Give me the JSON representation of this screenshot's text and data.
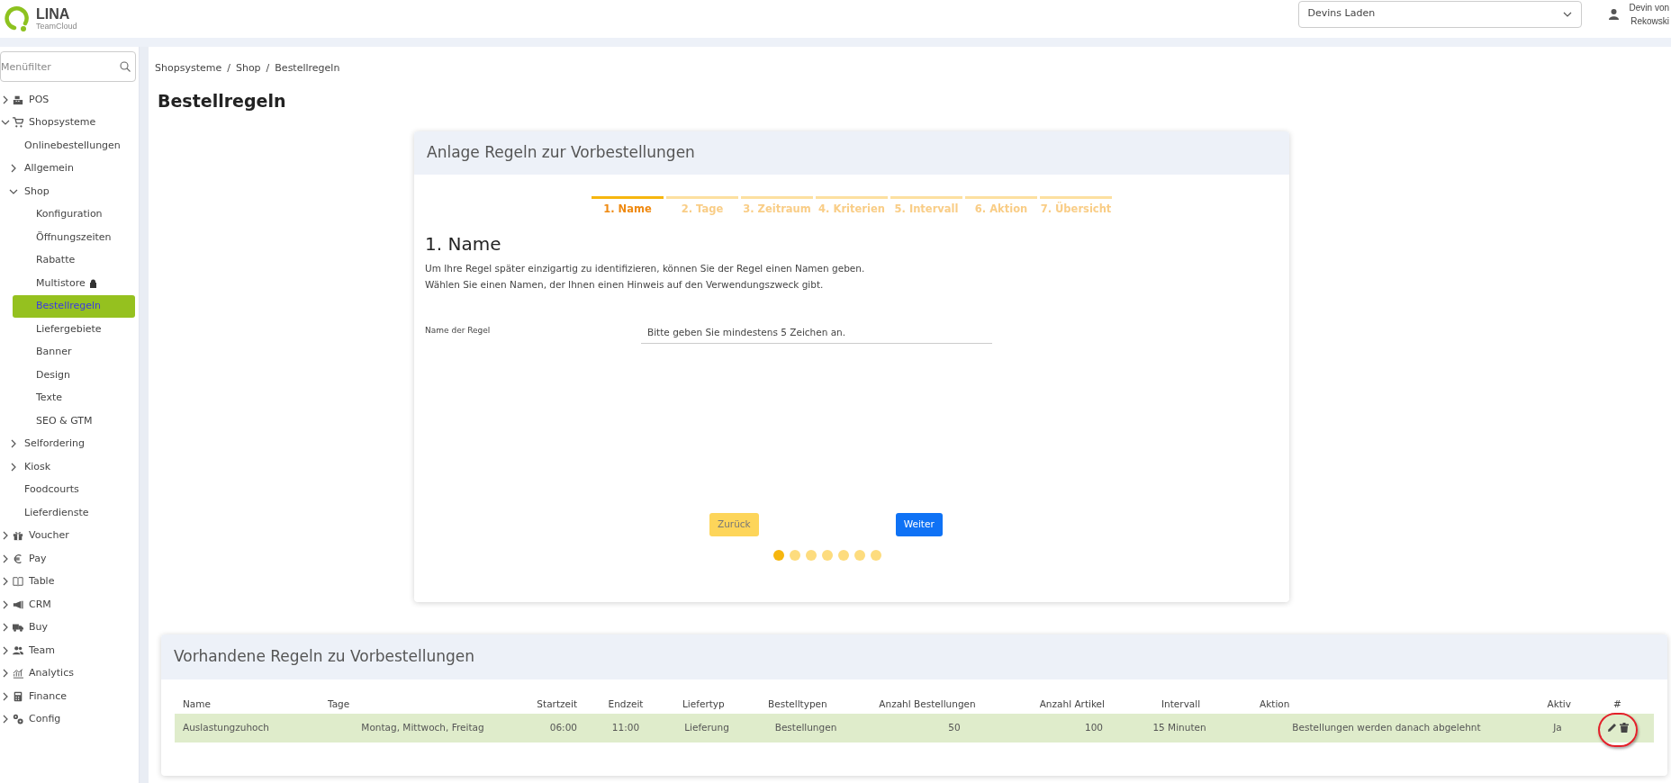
{
  "header": {
    "logo": {
      "name": "LINA",
      "tagline": "TeamCloud"
    },
    "store_select": {
      "value": "Devins Laden"
    },
    "user": {
      "name_lines": [
        "Devin von",
        "Rekowski"
      ]
    }
  },
  "sidebar": {
    "search": {
      "placeholder": "Menüfilter"
    },
    "items": [
      {
        "label": "POS",
        "expanded": false,
        "selected": false
      },
      {
        "label": "Shopsysteme",
        "expanded": true,
        "selected": false,
        "children": [
          {
            "label": "Onlinebestellungen",
            "selected": false
          },
          {
            "label": "Allgemein",
            "expanded": false,
            "selected": false
          },
          {
            "label": "Shop",
            "expanded": true,
            "selected": false,
            "children": [
              {
                "label": "Konfiguration",
                "selected": false,
                "locked": false
              },
              {
                "label": "Öffnungszeiten",
                "selected": false,
                "locked": false
              },
              {
                "label": "Rabatte",
                "selected": false,
                "locked": false
              },
              {
                "label": "Multistore",
                "selected": false,
                "locked": true
              },
              {
                "label": "Bestellregeln",
                "selected": true,
                "locked": false
              },
              {
                "label": "Liefergebiete",
                "selected": false,
                "locked": false
              },
              {
                "label": "Banner",
                "selected": false,
                "locked": false
              },
              {
                "label": "Design",
                "selected": false,
                "locked": false
              },
              {
                "label": "Texte",
                "selected": false,
                "locked": false
              },
              {
                "label": "SEO & GTM",
                "selected": false,
                "locked": false
              }
            ]
          },
          {
            "label": "Selfordering",
            "expanded": false,
            "selected": false
          },
          {
            "label": "Kiosk",
            "expanded": false,
            "selected": false
          },
          {
            "label": "Foodcourts",
            "selected": false
          },
          {
            "label": "Lieferdienste",
            "selected": false
          }
        ]
      },
      {
        "label": "Voucher",
        "expanded": false,
        "selected": false
      },
      {
        "label": "Pay",
        "expanded": false,
        "selected": false
      },
      {
        "label": "Table",
        "expanded": false,
        "selected": false
      },
      {
        "label": "CRM",
        "expanded": false,
        "selected": false
      },
      {
        "label": "Buy",
        "expanded": false,
        "selected": false
      },
      {
        "label": "Team",
        "expanded": false,
        "selected": false
      },
      {
        "label": "Analytics",
        "expanded": false,
        "selected": false
      },
      {
        "label": "Finance",
        "expanded": false,
        "selected": false
      },
      {
        "label": "Config",
        "expanded": false,
        "selected": false
      }
    ]
  },
  "breadcrumb": [
    "Shopsysteme",
    "Shop",
    "Bestellregeln"
  ],
  "breadcrumb_separator": "/",
  "page_title": "Bestellregeln",
  "wizard": {
    "title": "Anlage Regeln zur Vorbestellungen",
    "steps": [
      {
        "label": "1. Name",
        "selected": true
      },
      {
        "label": "2. Tage",
        "selected": false
      },
      {
        "label": "3. Zeitraum",
        "selected": false
      },
      {
        "label": "4. Kriterien",
        "selected": false
      },
      {
        "label": "5. Intervall",
        "selected": false
      },
      {
        "label": "6. Aktion",
        "selected": false
      },
      {
        "label": "7. Übersicht",
        "selected": false
      }
    ],
    "heading": "1. Name",
    "description": [
      "Um Ihre Regel später einzigartig zu identifizieren, können Sie der Regel einen Namen geben.",
      "Wählen Sie einen Namen, der Ihnen einen Hinweis auf den Verwendungszweck gibt."
    ],
    "field": {
      "label": "Name der Regel",
      "placeholder": "Bitte geben Sie mindestens 5 Zeichen an."
    },
    "back_button": "Zurück",
    "next_button": "Weiter"
  },
  "rules": {
    "title": "Vorhandene Regeln zu Vorbestellungen",
    "columns": [
      "Name",
      "Tage",
      "Startzeit",
      "Endzeit",
      "Liefertyp",
      "Bestelltypen",
      "Anzahl Bestellungen",
      "Anzahl Artikel",
      "Intervall",
      "Aktion",
      "Aktiv",
      "#"
    ],
    "rows": [
      {
        "cells": [
          "Auslastungzuhoch",
          "Montag, Mittwoch, Freitag",
          "06:00",
          "11:00",
          "Lieferung",
          "Bestellungen",
          "50",
          "100",
          "15 Minuten",
          "Bestellungen werden danach abgelehnt",
          "Ja"
        ],
        "actions_highlighted": true
      }
    ]
  }
}
